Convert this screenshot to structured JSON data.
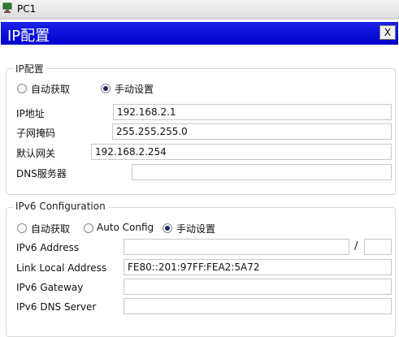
{
  "window": {
    "title": "PC1"
  },
  "dialog": {
    "title": "IP配置",
    "close_label": "X"
  },
  "ipv4": {
    "group_label": "IP配置",
    "radio_dhcp": "自动获取",
    "radio_static": "手动设置",
    "selected": "static",
    "ip_label": "IP地址",
    "ip_value": "192.168.2.1",
    "mask_label": "子网掩码",
    "mask_value": "255.255.255.0",
    "gateway_label": "默认网关",
    "gateway_value": "192.168.2.254",
    "dns_label": "DNS服务器",
    "dns_value": ""
  },
  "ipv6": {
    "group_label": "IPv6 Configuration",
    "radio_dhcp": "自动获取",
    "radio_auto": "Auto Config",
    "radio_static": "手动设置",
    "selected": "static",
    "address_label": "IPv6 Address",
    "address_value": "",
    "slash": "/",
    "prefix_value": "",
    "link_local_label": "Link Local Address",
    "link_local_value": "FE80::201:97FF:FEA2:5A72",
    "gateway_label": "IPv6 Gateway",
    "gateway_value": "",
    "dns_label": "IPv6 DNS Server",
    "dns_value": ""
  }
}
